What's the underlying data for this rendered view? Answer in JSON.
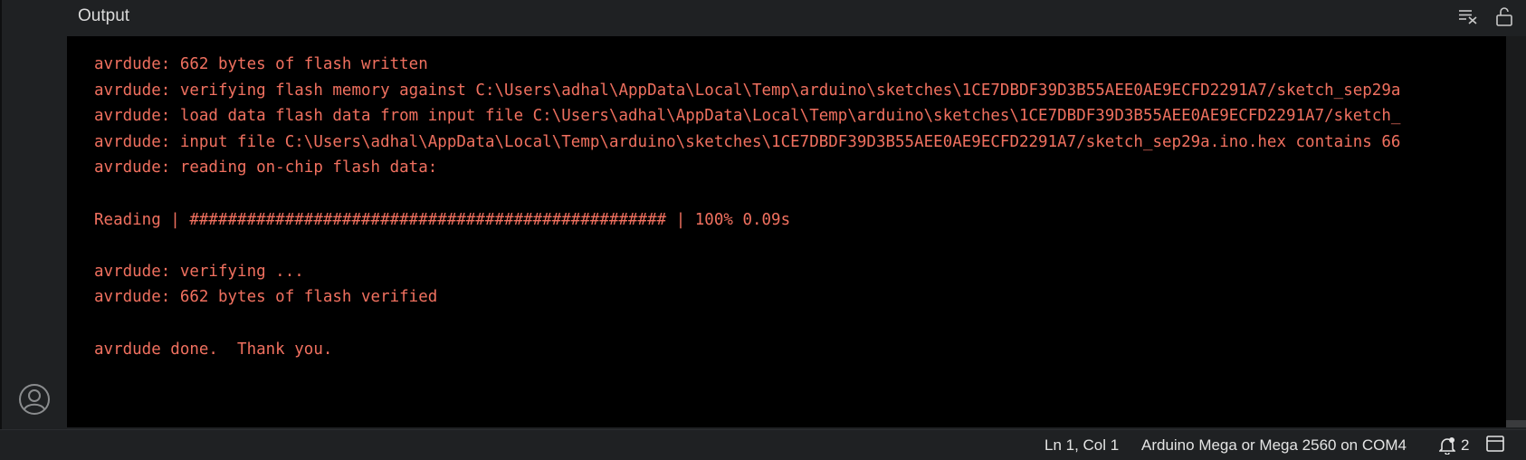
{
  "panel": {
    "title": "Output",
    "icons": [
      "clear-output-icon",
      "unlock-icon"
    ]
  },
  "output": {
    "lines": [
      "avrdude: 662 bytes of flash written",
      "avrdude: verifying flash memory against C:\\Users\\adhal\\AppData\\Local\\Temp\\arduino\\sketches\\1CE7DBDF39D3B55AEE0AE9ECFD2291A7/sketch_sep29a",
      "avrdude: load data flash data from input file C:\\Users\\adhal\\AppData\\Local\\Temp\\arduino\\sketches\\1CE7DBDF39D3B55AEE0AE9ECFD2291A7/sketch_",
      "avrdude: input file C:\\Users\\adhal\\AppData\\Local\\Temp\\arduino\\sketches\\1CE7DBDF39D3B55AEE0AE9ECFD2291A7/sketch_sep29a.ino.hex contains 66",
      "avrdude: reading on-chip flash data:",
      "",
      "Reading | ################################################## | 100% 0.09s",
      "",
      "avrdude: verifying ...",
      "avrdude: 662 bytes of flash verified",
      "",
      "avrdude done.  Thank you."
    ],
    "text_color": "#f0705f"
  },
  "status_bar": {
    "cursor": "Ln 1, Col 1",
    "board": "Arduino Mega or Mega 2560 on COM4",
    "notifications_count": "2"
  },
  "sidebar": {
    "icons": [
      "account-icon"
    ]
  }
}
